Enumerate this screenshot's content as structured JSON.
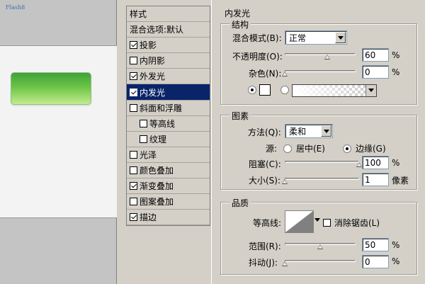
{
  "preview": {
    "label": "Flash8",
    "button_color": "#6bc446"
  },
  "styles": {
    "header": "样式",
    "blend_options": "混合选项:默认",
    "items": [
      {
        "label": "投影",
        "checked": true,
        "indent": false,
        "selected": false
      },
      {
        "label": "内阴影",
        "checked": false,
        "indent": false,
        "selected": false
      },
      {
        "label": "外发光",
        "checked": true,
        "indent": false,
        "selected": false
      },
      {
        "label": "内发光",
        "checked": true,
        "indent": false,
        "selected": true
      },
      {
        "label": "斜面和浮雕",
        "checked": false,
        "indent": false,
        "selected": false
      },
      {
        "label": "等高线",
        "checked": false,
        "indent": true,
        "selected": false
      },
      {
        "label": "纹理",
        "checked": false,
        "indent": true,
        "selected": false
      },
      {
        "label": "光泽",
        "checked": false,
        "indent": false,
        "selected": false
      },
      {
        "label": "颜色叠加",
        "checked": false,
        "indent": false,
        "selected": false
      },
      {
        "label": "渐变叠加",
        "checked": true,
        "indent": false,
        "selected": false
      },
      {
        "label": "图案叠加",
        "checked": false,
        "indent": false,
        "selected": false
      },
      {
        "label": "描边",
        "checked": true,
        "indent": false,
        "selected": false
      }
    ],
    "selected_color": "#0a246a"
  },
  "inner_glow": {
    "title": "内发光",
    "structure": {
      "title": "结构",
      "blend_mode_label": "混合模式(B):",
      "blend_mode_value": "正常",
      "opacity_label": "不透明度(O):",
      "opacity_value": "60",
      "opacity_unit": "%",
      "opacity_fraction": 0.6,
      "noise_label": "杂色(N):",
      "noise_value": "0",
      "noise_unit": "%",
      "noise_fraction": 0.0
    },
    "elements": {
      "title": "图素",
      "method_label": "方法(Q):",
      "method_value": "柔和",
      "source_label": "源:",
      "source_center": "居中(E)",
      "source_edge": "边缘(G)",
      "choke_label": "阻塞(C):",
      "choke_value": "100",
      "choke_unit": "%",
      "choke_fraction": 1.0,
      "size_label": "大小(S):",
      "size_value": "1",
      "size_unit": "像素",
      "size_fraction": 0.0
    },
    "quality": {
      "title": "品质",
      "contour_label": "等高线:",
      "antialias_label": "消除锯齿(L)",
      "range_label": "范围(R):",
      "range_value": "50",
      "range_unit": "%",
      "range_fraction": 0.5,
      "jitter_label": "抖动(J):",
      "jitter_value": "0",
      "jitter_unit": "%",
      "jitter_fraction": 0.0
    }
  }
}
